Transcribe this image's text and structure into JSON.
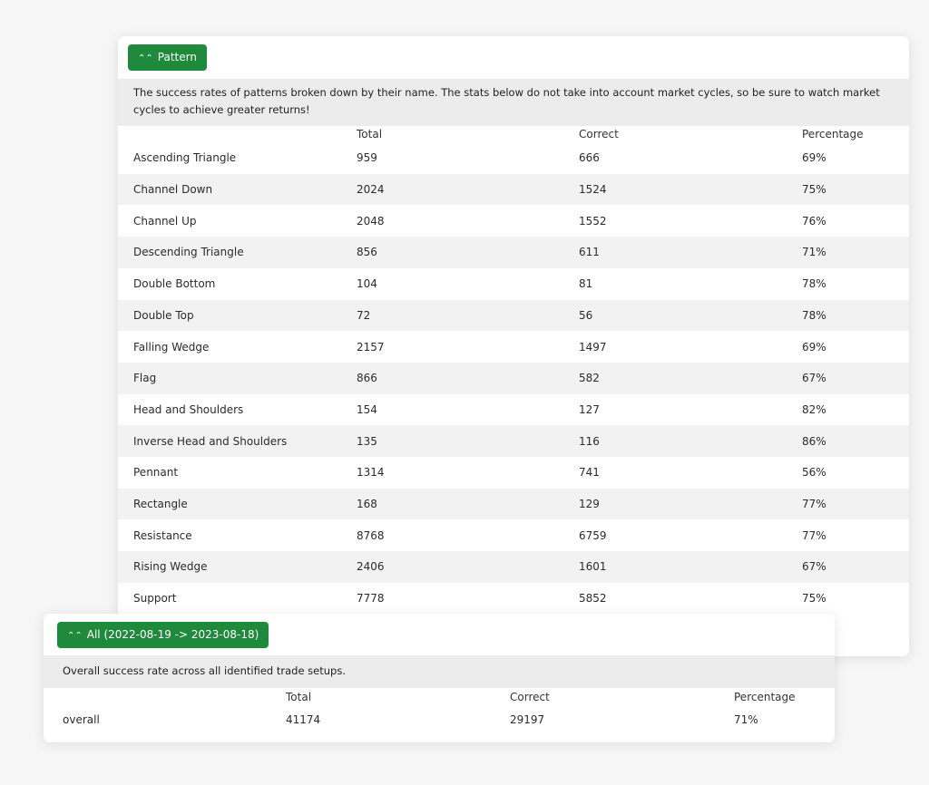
{
  "pattern_panel": {
    "button_label": "Pattern",
    "description": "The success rates of patterns broken down by their name. The stats below do not take into account market cycles, so be sure to watch market cycles to achieve greater returns!",
    "columns": [
      "Total",
      "Correct",
      "Percentage"
    ],
    "rows": [
      {
        "name": "Ascending Triangle",
        "total": "959",
        "correct": "666",
        "percentage": "69%"
      },
      {
        "name": "Channel Down",
        "total": "2024",
        "correct": "1524",
        "percentage": "75%"
      },
      {
        "name": "Channel Up",
        "total": "2048",
        "correct": "1552",
        "percentage": "76%"
      },
      {
        "name": "Descending Triangle",
        "total": "856",
        "correct": "611",
        "percentage": "71%"
      },
      {
        "name": "Double Bottom",
        "total": "104",
        "correct": "81",
        "percentage": "78%"
      },
      {
        "name": "Double Top",
        "total": "72",
        "correct": "56",
        "percentage": "78%"
      },
      {
        "name": "Falling Wedge",
        "total": "2157",
        "correct": "1497",
        "percentage": "69%"
      },
      {
        "name": "Flag",
        "total": "866",
        "correct": "582",
        "percentage": "67%"
      },
      {
        "name": "Head and Shoulders",
        "total": "154",
        "correct": "127",
        "percentage": "82%"
      },
      {
        "name": "Inverse Head and Shoulders",
        "total": "135",
        "correct": "116",
        "percentage": "86%"
      },
      {
        "name": "Pennant",
        "total": "1314",
        "correct": "741",
        "percentage": "56%"
      },
      {
        "name": "Rectangle",
        "total": "168",
        "correct": "129",
        "percentage": "77%"
      },
      {
        "name": "Resistance",
        "total": "8768",
        "correct": "6759",
        "percentage": "77%"
      },
      {
        "name": "Rising Wedge",
        "total": "2406",
        "correct": "1601",
        "percentage": "67%"
      },
      {
        "name": "Support",
        "total": "7778",
        "correct": "5852",
        "percentage": "75%"
      }
    ]
  },
  "overall_panel": {
    "button_label": "All (2022-08-19 -> 2023-08-18)",
    "description": "Overall success rate across all identified trade setups.",
    "columns": [
      "Total",
      "Correct",
      "Percentage"
    ],
    "rows": [
      {
        "name": "overall",
        "total": "41174",
        "correct": "29197",
        "percentage": "71%"
      }
    ]
  },
  "colors": {
    "accent": "#1f8a3b",
    "description_bg": "#ececec",
    "row_alt_bg": "#f2f2f2",
    "page_bg": "#f6f6f6"
  },
  "icons": {
    "collapse": "double-chevron-up-icon"
  }
}
